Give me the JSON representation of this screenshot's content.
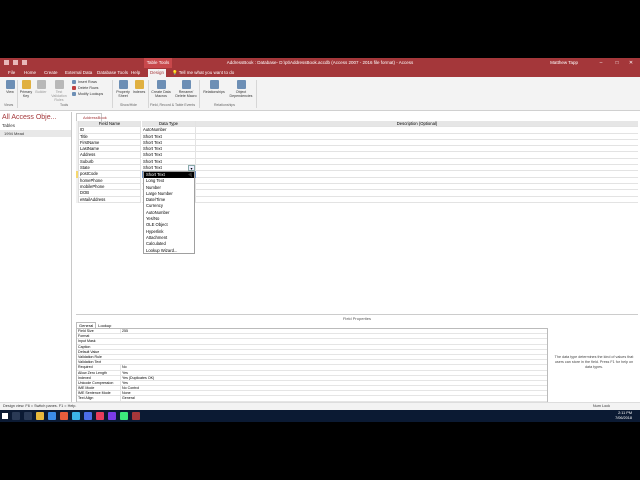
{
  "titlebar": {
    "contextual_tab": "Table Tools",
    "document": "AddressBook : Database- D:\\pt\\AddressBook.accdb (Access 2007 - 2016 file format) - Access",
    "user": "Matthew Tapp",
    "minimize": "–",
    "maximize": "□",
    "close": "✕"
  },
  "menu": {
    "file": "File",
    "home": "Home",
    "create": "Create",
    "external": "External Data",
    "dbtools": "Database Tools",
    "help": "Help",
    "design": "Design",
    "tellme": "Tell me what you want to do"
  },
  "ribbon": {
    "view": "View",
    "primary_key": "Primary Key",
    "builder": "Builder",
    "test_validation": "Test Validation Rules",
    "insert_rows": "Insert Rows",
    "delete_rows": "Delete Rows",
    "modify_lookups": "Modify Lookups",
    "property_sheet": "Property Sheet",
    "indexes": "Indexes",
    "create_data_macros": "Create Data Macros",
    "rename_delete_macro": "Rename/ Delete Macro",
    "relationships": "Relationships",
    "object_dependencies": "Object Dependencies",
    "groups": {
      "views": "Views",
      "tools": "Tools",
      "show_hide": "Show/Hide",
      "field_record_events": "Field, Record & Table Events",
      "relationships": "Relationships"
    }
  },
  "nav": {
    "header": "All Access Obje...",
    "section": "Tables",
    "items": [
      "1994 Mead"
    ]
  },
  "doc_tab": "AddressBook",
  "grid": {
    "headers": [
      "Field Name",
      "Data Type",
      "Description (Optional)"
    ],
    "rows": [
      {
        "name": "ID",
        "type": "AutoNumber"
      },
      {
        "name": "Title",
        "type": "Short Text"
      },
      {
        "name": "FirstName",
        "type": "Short Text"
      },
      {
        "name": "LastName",
        "type": "Short Text"
      },
      {
        "name": "Address",
        "type": "Short Text"
      },
      {
        "name": "Suburb",
        "type": "Short Text"
      },
      {
        "name": "State",
        "type": "Short Text"
      },
      {
        "name": "postCode",
        "type": "Short Text"
      },
      {
        "name": "homePhone",
        "type": ""
      },
      {
        "name": "mobilePhone",
        "type": ""
      },
      {
        "name": "DOB",
        "type": ""
      },
      {
        "name": "eMailAddress",
        "type": ""
      }
    ]
  },
  "dropdown": {
    "options": [
      "Short Text",
      "Long Text",
      "Number",
      "Large Number",
      "Date/Time",
      "Currency",
      "AutoNumber",
      "Yes/No",
      "OLE Object",
      "Hyperlink",
      "Attachment",
      "Calculated",
      "Lookup Wizard..."
    ],
    "selected": "Short Text"
  },
  "field_properties": {
    "title": "Field Properties",
    "tabs": [
      "General",
      "Lookup"
    ],
    "rows": [
      {
        "label": "Field Size",
        "value": "255"
      },
      {
        "label": "Format",
        "value": ""
      },
      {
        "label": "Input Mask",
        "value": ""
      },
      {
        "label": "Caption",
        "value": ""
      },
      {
        "label": "Default Value",
        "value": ""
      },
      {
        "label": "Validation Rule",
        "value": ""
      },
      {
        "label": "Validation Text",
        "value": ""
      },
      {
        "label": "Required",
        "value": "No"
      },
      {
        "label": "Allow Zero Length",
        "value": "Yes"
      },
      {
        "label": "Indexed",
        "value": "Yes (Duplicates OK)"
      },
      {
        "label": "Unicode Compression",
        "value": "Yes"
      },
      {
        "label": "IME Mode",
        "value": "No Control"
      },
      {
        "label": "IME Sentence Mode",
        "value": "None"
      },
      {
        "label": "Text Align",
        "value": "General"
      }
    ],
    "help": "The data type determines the kind of values that users can store in the field. Press F1 for help on data types."
  },
  "status": {
    "left": "Design view.  F6 = Switch panes.  F1 = Help.",
    "numlock": "Num Lock"
  },
  "taskbar": {
    "time": "2:11 PM",
    "date": "7/06/2018"
  },
  "colors": {
    "accent": "#a4373a",
    "taskbar": "#0b1a33"
  }
}
